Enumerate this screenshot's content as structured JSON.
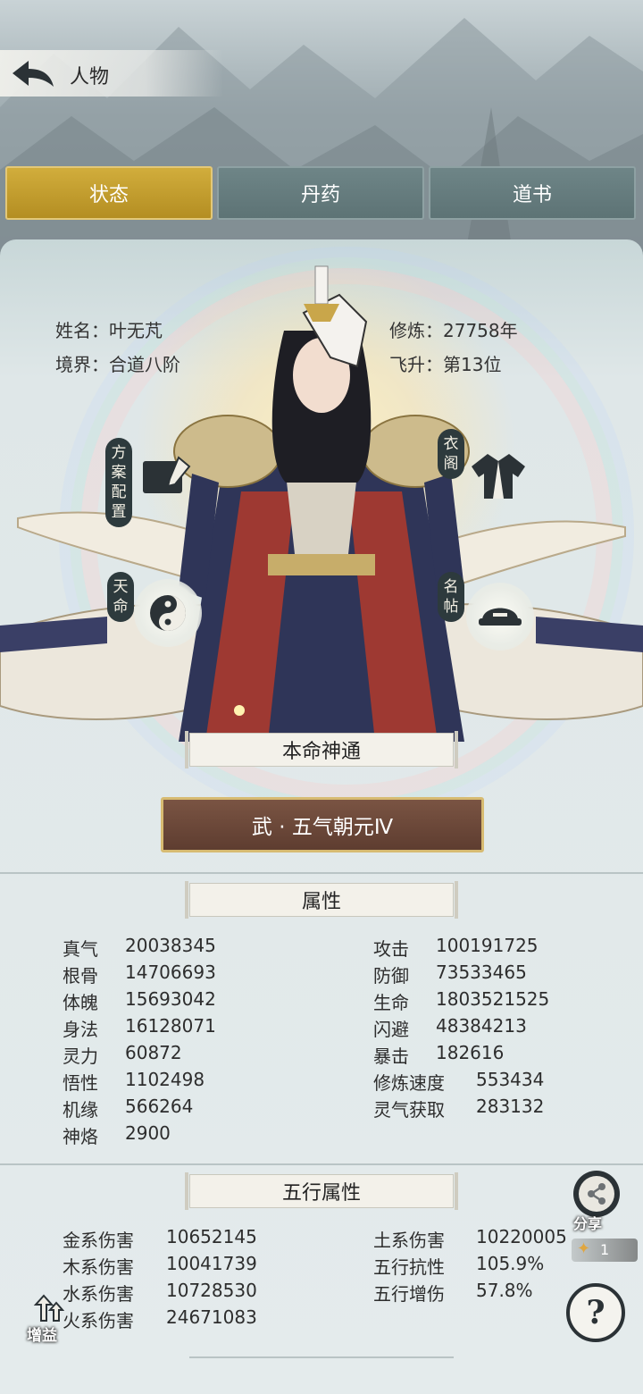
{
  "header": {
    "title": "人物"
  },
  "tabs": [
    {
      "label": "状态",
      "active": true
    },
    {
      "label": "丹药",
      "active": false
    },
    {
      "label": "道书",
      "active": false
    }
  ],
  "character": {
    "name_label": "姓名：叶无芃",
    "realm_label": "境界：合道八阶",
    "cultivation_label": "修炼：27758年",
    "ascension_label": "飞升：第13位"
  },
  "side_buttons": {
    "plan": "方案配置",
    "outfit": "衣阁",
    "fate": "天命",
    "card": "名帖"
  },
  "destiny": {
    "title": "本命神通",
    "skill": "武 · 五气朝元Ⅳ"
  },
  "attributes": {
    "title": "属性",
    "left": [
      {
        "k": "真气",
        "v": "20038345"
      },
      {
        "k": "根骨",
        "v": "14706693"
      },
      {
        "k": "体魄",
        "v": "15693042"
      },
      {
        "k": "身法",
        "v": "16128071"
      },
      {
        "k": "灵力",
        "v": "60872"
      },
      {
        "k": "悟性",
        "v": "1102498"
      },
      {
        "k": "机缘",
        "v": "566264"
      },
      {
        "k": "神烙",
        "v": "2900"
      }
    ],
    "right": [
      {
        "k": "攻击",
        "v": "100191725"
      },
      {
        "k": "防御",
        "v": "73533465"
      },
      {
        "k": "生命",
        "v": "1803521525"
      },
      {
        "k": "闪避",
        "v": "48384213"
      },
      {
        "k": "暴击",
        "v": "182616"
      },
      {
        "k": "修炼速度",
        "v": "553434"
      },
      {
        "k": "灵气获取",
        "v": "283132"
      }
    ]
  },
  "elements": {
    "title": "五行属性",
    "left": [
      {
        "k": "金系伤害",
        "v": "10652145"
      },
      {
        "k": "木系伤害",
        "v": "10041739"
      },
      {
        "k": "水系伤害",
        "v": "10728530"
      },
      {
        "k": "火系伤害",
        "v": "24671083"
      }
    ],
    "right": [
      {
        "k": "土系伤害",
        "v": "10220005"
      },
      {
        "k": "五行抗性",
        "v": "105.9%"
      },
      {
        "k": "五行增伤",
        "v": "57.8%"
      }
    ]
  },
  "floating": {
    "share": "分享",
    "share_count": "1",
    "buff": "增益",
    "help": "?"
  },
  "colors": {
    "active_tab": "#c9a335",
    "inactive_tab": "#667d7f",
    "skill_button": "#6b4839",
    "panel": "#e2e9ea"
  }
}
